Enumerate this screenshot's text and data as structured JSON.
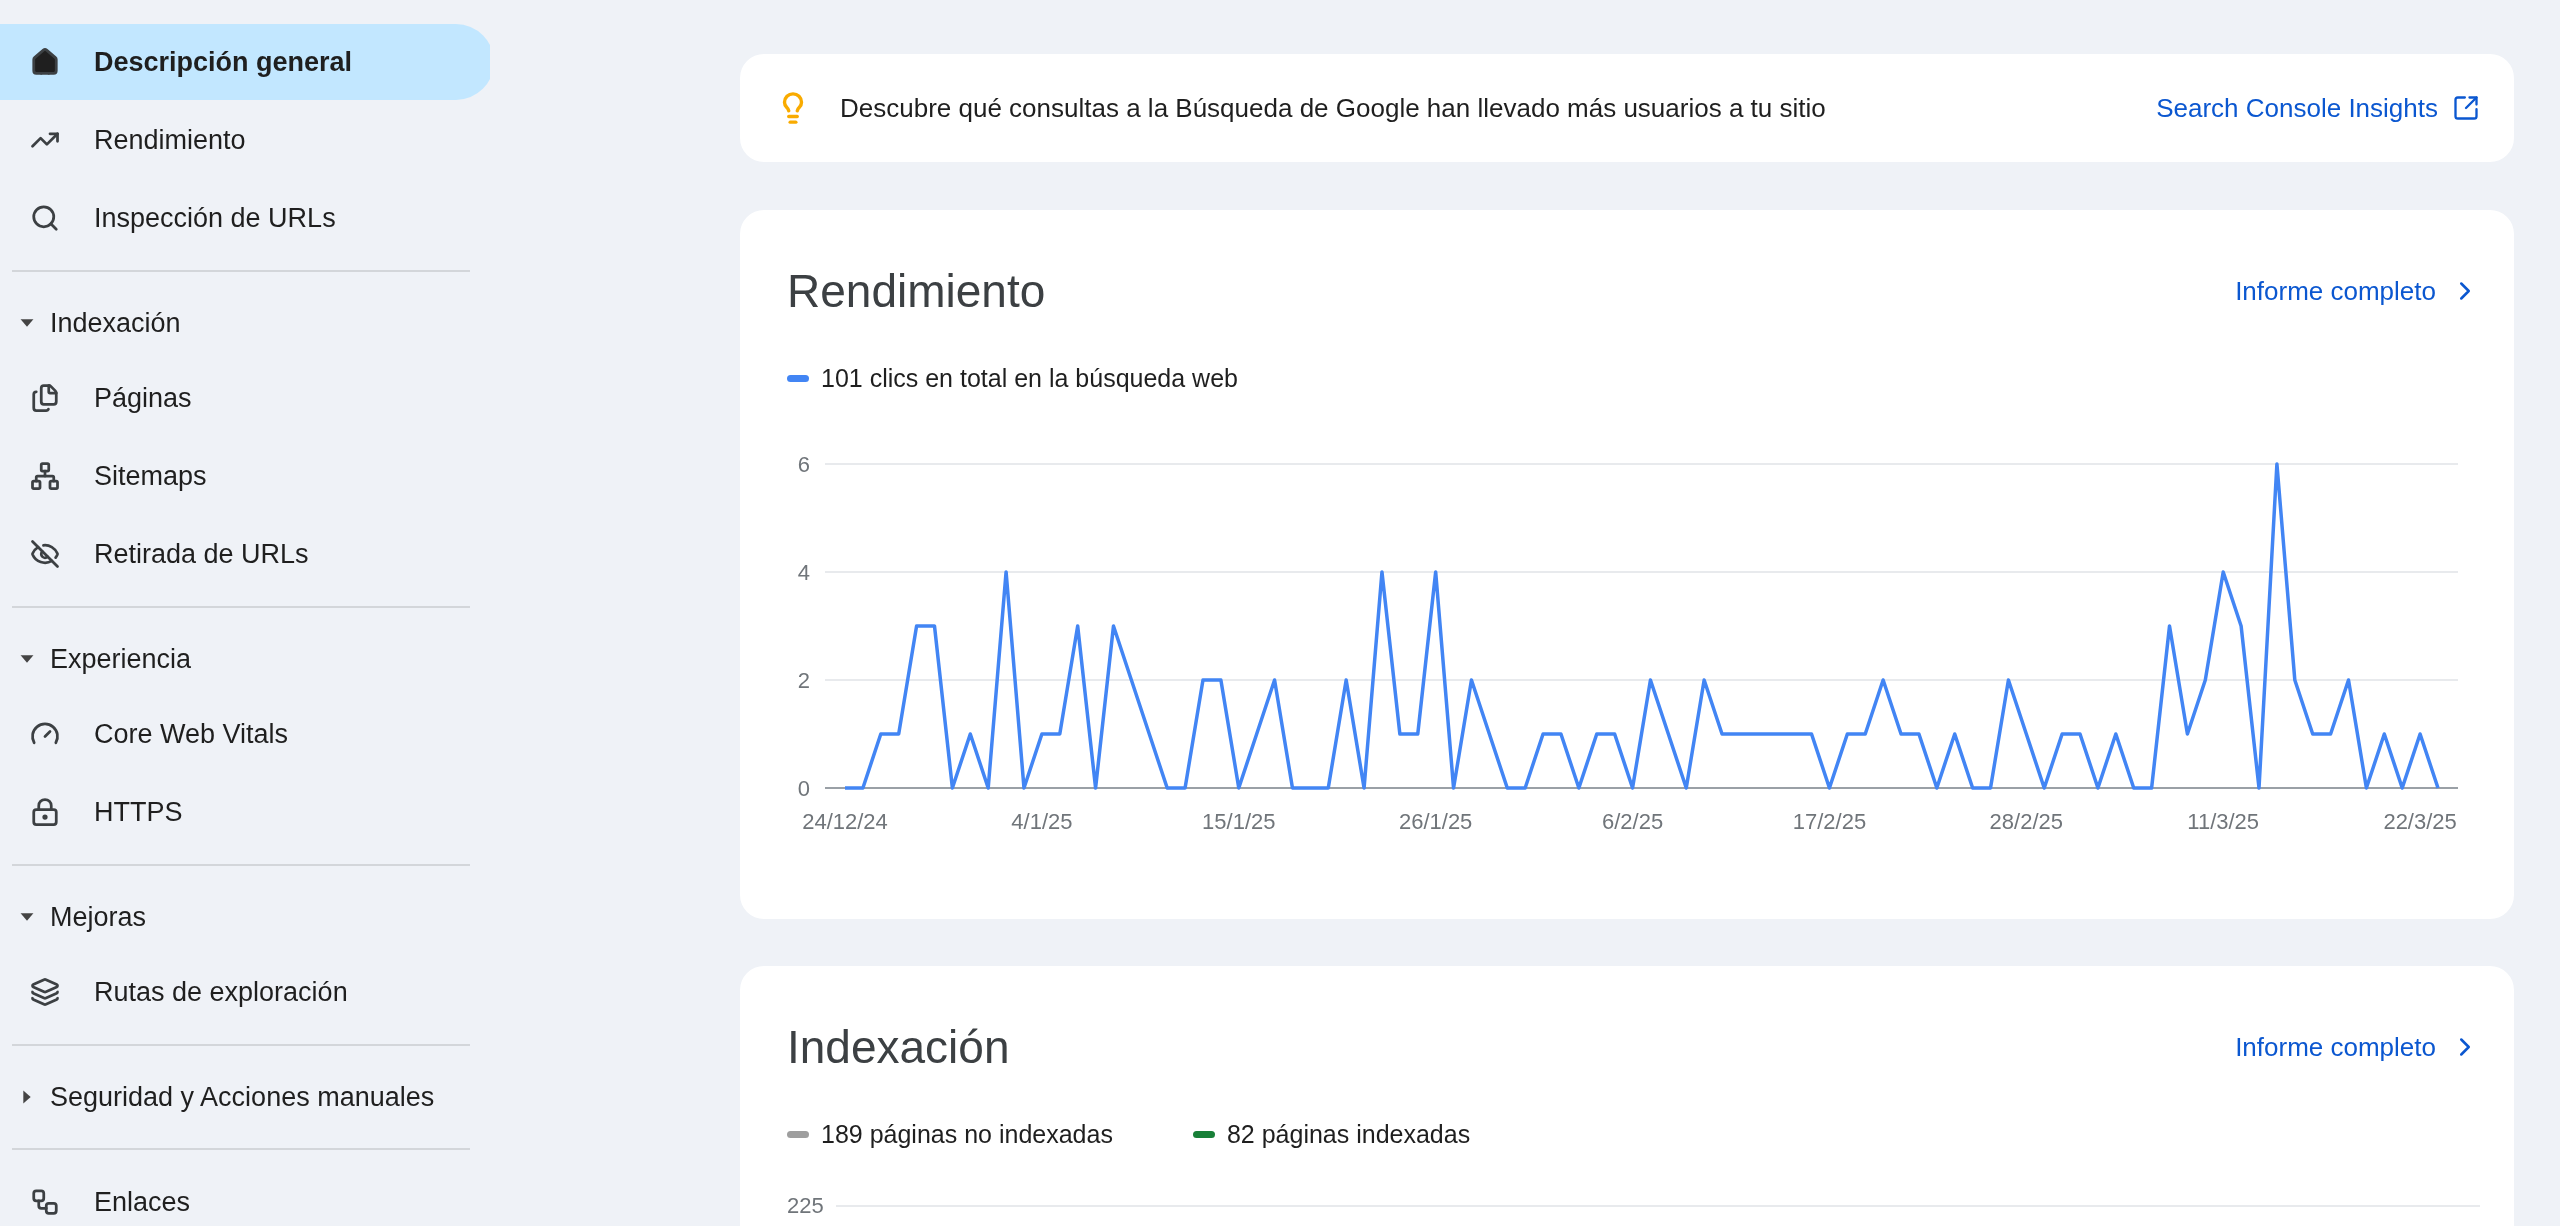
{
  "sidebar": {
    "groups": [
      {
        "items": [
          {
            "label": "Descripción general",
            "selected": true
          },
          {
            "label": "Rendimiento",
            "selected": false
          },
          {
            "label": "Inspección de URLs",
            "selected": false
          }
        ]
      },
      {
        "title": "Indexación",
        "expanded": true,
        "items": [
          {
            "label": "Páginas",
            "selected": false
          },
          {
            "label": "Sitemaps",
            "selected": false
          },
          {
            "label": "Retirada de URLs",
            "selected": false
          }
        ]
      },
      {
        "title": "Experiencia",
        "expanded": true,
        "items": [
          {
            "label": "Core Web Vitals",
            "selected": false
          },
          {
            "label": "HTTPS",
            "selected": false
          }
        ]
      },
      {
        "title": "Mejoras",
        "expanded": true,
        "items": [
          {
            "label": "Rutas de exploración",
            "selected": false
          }
        ]
      },
      {
        "title": "Seguridad y Acciones manuales",
        "expanded": false
      },
      {
        "items": [
          {
            "label": "Enlaces",
            "selected": false
          }
        ]
      }
    ]
  },
  "insight": {
    "text": "Descubre qué consultas a la Búsqueda de Google han llevado más usuarios a tu sitio",
    "link": "Search Console Insights"
  },
  "performance": {
    "title": "Rendimiento",
    "link": "Informe completo",
    "chart_data": {
      "type": "line",
      "categories": [
        "24/12/24",
        null,
        null,
        null,
        null,
        null,
        null,
        null,
        null,
        null,
        null,
        "4/1/25",
        null,
        null,
        null,
        null,
        null,
        null,
        null,
        null,
        null,
        null,
        "15/1/25",
        null,
        null,
        null,
        null,
        null,
        null,
        null,
        null,
        null,
        null,
        "26/1/25",
        null,
        null,
        null,
        null,
        null,
        null,
        null,
        null,
        null,
        null,
        "6/2/25",
        null,
        null,
        null,
        null,
        null,
        null,
        null,
        null,
        null,
        null,
        "17/2/25",
        null,
        null,
        null,
        null,
        null,
        null,
        null,
        null,
        null,
        null,
        "28/2/25",
        null,
        null,
        null,
        null,
        null,
        null,
        null,
        null,
        null,
        null,
        "11/3/25",
        null,
        null,
        null,
        null,
        null,
        null,
        null,
        null,
        null,
        null,
        "22/3/25",
        null
      ],
      "series": [
        {
          "name": "101 clics en total en la búsqueda web",
          "color": "#4285f4",
          "values": [
            0,
            0,
            1,
            1,
            3,
            3,
            0,
            1,
            0,
            4,
            0,
            1,
            1,
            3,
            0,
            3,
            2,
            1,
            0,
            0,
            2,
            2,
            0,
            1,
            2,
            0,
            0,
            0,
            2,
            0,
            4,
            1,
            1,
            4,
            0,
            2,
            1,
            0,
            0,
            1,
            1,
            0,
            1,
            1,
            0,
            2,
            1,
            0,
            2,
            1,
            1,
            1,
            1,
            1,
            1,
            0,
            1,
            1,
            2,
            1,
            1,
            0,
            1,
            0,
            0,
            2,
            1,
            0,
            1,
            1,
            0,
            1,
            0,
            0,
            3,
            1,
            2,
            4,
            3,
            0,
            6,
            2,
            1,
            1,
            2,
            0,
            1,
            0,
            1,
            0
          ]
        }
      ],
      "ylim": [
        0,
        6
      ],
      "yticks": [
        0,
        2,
        4,
        6
      ]
    }
  },
  "indexing": {
    "title": "Indexación",
    "link": "Informe completo",
    "legend": [
      {
        "label": "189 páginas no indexadas",
        "color": "#9e9e9e"
      },
      {
        "label": "82 páginas indexadas",
        "color": "#188038"
      }
    ],
    "y_tick": "225"
  }
}
